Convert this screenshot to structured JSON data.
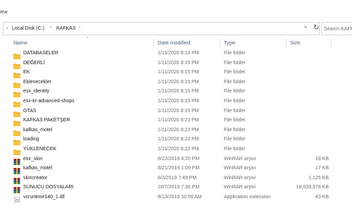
{
  "ribbon": {
    "tab_label": "iew"
  },
  "address": {
    "crumbs": [
      "Local Disk (C:)",
      "KAFKAS"
    ]
  },
  "search": {
    "placeholder": "Search KAFKAS"
  },
  "columns": {
    "name": "Name",
    "date": "Date modified",
    "type": "Type",
    "size": "Size"
  },
  "colors": {
    "folder": "#f6c244",
    "folder_dark": "#e0a526",
    "winrar_red": "#a8261d",
    "winrar_blue": "#2c4fa8",
    "header_text": "#4c607a",
    "meta_text": "#6d6d6d"
  },
  "files": [
    {
      "name": "DATABASELER",
      "date": "1/11/2020 8:14 PM",
      "type": "File folder",
      "size": "",
      "icon": "folder-icon"
    },
    {
      "name": "DEĞERLİ",
      "date": "1/11/2020 8:15 PM",
      "type": "File folder",
      "size": "",
      "icon": "folder-icon"
    },
    {
      "name": "EK",
      "date": "1/11/2020 8:15 PM",
      "type": "File folder",
      "size": "",
      "icon": "folder-icon"
    },
    {
      "name": "Eklenecekler",
      "date": "1/11/2020 8:15 PM",
      "type": "File folder",
      "size": "",
      "icon": "folder-icon"
    },
    {
      "name": "esx_identity",
      "date": "1/11/2020 8:15 PM",
      "type": "File folder",
      "size": "",
      "icon": "folder-icon"
    },
    {
      "name": "esx-kr-advanced-shops",
      "date": "1/11/2020 8:15 PM",
      "type": "File folder",
      "size": "",
      "icon": "folder-icon"
    },
    {
      "name": "GTAS",
      "date": "1/11/2020 8:15 PM",
      "type": "File folder",
      "size": "",
      "icon": "folder-icon"
    },
    {
      "name": "KAFKAS PAKETŞER",
      "date": "1/11/2020 8:21 PM",
      "type": "File folder",
      "size": "",
      "icon": "folder-icon"
    },
    {
      "name": "kafkas_motel",
      "date": "1/11/2020 8:22 PM",
      "type": "File folder",
      "size": "",
      "icon": "folder-icon"
    },
    {
      "name": "loading",
      "date": "1/11/2020 8:22 PM",
      "type": "File folder",
      "size": "",
      "icon": "folder-icon"
    },
    {
      "name": "YÜKLENECEK",
      "date": "1/11/2020 8:22 PM",
      "type": "File folder",
      "size": "",
      "icon": "folder-icon"
    },
    {
      "name": "esx_skin",
      "date": "8/22/2019 4:20 PM",
      "type": "WinRAR arşivi",
      "size": "18 KB",
      "icon": "winrar-archive-icon"
    },
    {
      "name": "kafkas_motel",
      "date": "8/21/2019 1:09 PM",
      "type": "WinRAR arşivi",
      "size": "17 KB",
      "icon": "winrar-archive-icon"
    },
    {
      "name": "skincreator",
      "date": "8/3/2019 7:49 PM",
      "type": "WinRAR arşivi",
      "size": "1,125 KB",
      "icon": "winrar-archive-icon"
    },
    {
      "name": "SUNUCU DOSYALARI",
      "date": "10/7/2019 7:36 PM",
      "type": "WinRAR arşivi",
      "size": "18,039,978 KB",
      "icon": "winrar-archive-icon"
    },
    {
      "name": "vcruntime140_1.dll",
      "date": "8/13/2019 10:59 AM",
      "type": "Application extension",
      "size": "43 KB",
      "icon": "dll-file-icon"
    }
  ]
}
